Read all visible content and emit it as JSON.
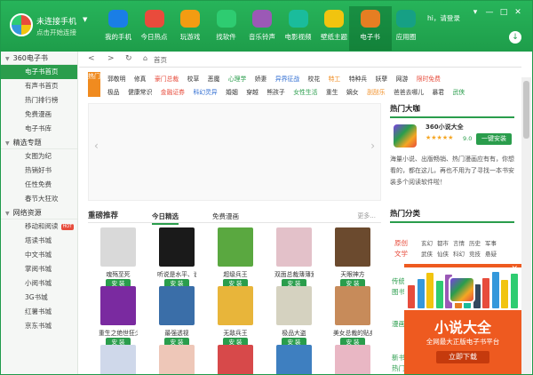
{
  "account": {
    "line1": "未连接手机",
    "line2": "点击开始连接",
    "dropdown": "▼"
  },
  "nav": [
    {
      "label": "我的手机",
      "color": "#1a7ee6"
    },
    {
      "label": "今日热点",
      "color": "#e94b3c"
    },
    {
      "label": "玩游戏",
      "color": "#f39c12"
    },
    {
      "label": "找软件",
      "color": "#2ecc71"
    },
    {
      "label": "音乐铃声",
      "color": "#9b59b6"
    },
    {
      "label": "电影视频",
      "color": "#1abc9c"
    },
    {
      "label": "壁纸主题",
      "color": "#f1c40f"
    },
    {
      "label": "电子书",
      "color": "#e67e22"
    },
    {
      "label": "应用圈",
      "color": "#16a085"
    }
  ],
  "header": {
    "hi": "hi，请登录",
    "win_buttons": [
      "▾",
      "—",
      "□",
      "✕"
    ],
    "download_icon": "↓"
  },
  "sidebar": {
    "sections": [
      {
        "title": "360电子书",
        "items": [
          {
            "label": "电子书首页",
            "active": true
          },
          {
            "label": "有声书首页"
          },
          {
            "label": "热门排行榜"
          },
          {
            "label": "免费漫画"
          },
          {
            "label": "电子书库"
          }
        ]
      },
      {
        "title": "精选专题",
        "items": [
          {
            "label": "女图为纪"
          },
          {
            "label": "热销好书"
          },
          {
            "label": "任性免费"
          },
          {
            "label": "春节大狂欢"
          }
        ]
      },
      {
        "title": "网络资源",
        "items": [
          {
            "label": "移动和阅读",
            "badge": "HOT"
          },
          {
            "label": "塔读书城"
          },
          {
            "label": "中文书城"
          },
          {
            "label": "掌阅书城"
          },
          {
            "label": "小阅书城"
          },
          {
            "label": "3G书城"
          },
          {
            "label": "红薯书城"
          },
          {
            "label": "京东书城"
          }
        ]
      }
    ]
  },
  "address": {
    "back": "<",
    "forward": ">",
    "refresh": "↻",
    "home_label": "首页"
  },
  "categories": {
    "hot_label": "热门",
    "row1": [
      {
        "t": "郭敬明"
      },
      {
        "t": "修真"
      },
      {
        "t": "豪门总裁",
        "c": "r"
      },
      {
        "t": "校草"
      },
      {
        "t": "恶魔"
      },
      {
        "t": "心理学",
        "c": "g"
      },
      {
        "t": "娇妻"
      },
      {
        "t": "异界征战",
        "c": "b"
      },
      {
        "t": "校花"
      },
      {
        "t": "特工",
        "c": "o"
      },
      {
        "t": "特种兵"
      },
      {
        "t": "妖孽"
      },
      {
        "t": "网游"
      },
      {
        "t": "限时免费",
        "c": "r"
      }
    ],
    "row2": [
      {
        "t": "极品"
      },
      {
        "t": "健康常识"
      },
      {
        "t": "金融证券",
        "c": "r"
      },
      {
        "t": "科幻灵异",
        "c": "b"
      },
      {
        "t": "婚姻"
      },
      {
        "t": "穿越"
      },
      {
        "t": "熊孩子"
      },
      {
        "t": "女性生活",
        "c": "g"
      },
      {
        "t": "重生"
      },
      {
        "t": "嫡女"
      },
      {
        "t": "刮刮乐",
        "c": "o"
      },
      {
        "t": "爸爸去哪儿"
      },
      {
        "t": "暴君"
      },
      {
        "t": "武侠",
        "c": "g"
      }
    ]
  },
  "banner": {
    "prev": "‹",
    "next": "›"
  },
  "hot_read": {
    "title": "热门大咖",
    "app_name": "360小说大全",
    "stars": "★★★★★",
    "score": "9.0",
    "install": "一键安装",
    "desc": "海量小说、出版畅销、热门漫画应有有，你想看的，都在这儿，再也不用为了寻找一本书安装多个阅读软件啦！"
  },
  "recommend": {
    "title": "重磅推荐",
    "tabs": [
      "今日精选",
      "免费漫画"
    ],
    "more": "更多...",
    "install": "安 装",
    "books": [
      {
        "title": "魂殇至死",
        "color": "#d9d9d9"
      },
      {
        "title": "听说是水平、说...",
        "color": "#1a1a1a"
      },
      {
        "title": "超级兵王",
        "color": "#5aa840"
      },
      {
        "title": "双面总裁薄薄爱",
        "color": "#e3c1c9"
      },
      {
        "title": "天眼神方",
        "color": "#6b4a2e"
      },
      {
        "title": "重生之绝世狂少",
        "color": "#7a2aa0"
      },
      {
        "title": "最强透视",
        "color": "#3a6ea8"
      },
      {
        "title": "无敌兵王",
        "color": "#e8b53a"
      },
      {
        "title": "极品大盗",
        "color": "#d5d2c0"
      },
      {
        "title": "美女总裁的贴身",
        "color": "#c78b5a"
      },
      {
        "title": "",
        "color": "#cfd8ea"
      },
      {
        "title": "",
        "color": "#eec7b8"
      },
      {
        "title": "",
        "color": "#d7494a"
      },
      {
        "title": "",
        "color": "#3e7fc0"
      },
      {
        "title": "",
        "color": "#e9b7c4"
      }
    ]
  },
  "hot_categories": {
    "title": "热门分类",
    "group": "原创文学",
    "row1": [
      "玄幻",
      "都市",
      "言情",
      "历史",
      "军事"
    ],
    "row2": [
      "武侠",
      "仙侠",
      "科幻",
      "竞技",
      "悬疑"
    ]
  },
  "side_peek": [
    "传统",
    "图书",
    "漫画",
    "新书",
    "热门"
  ],
  "ad": {
    "close": "✕",
    "title": "小说大全",
    "sub": "全网最大正版电子书平台",
    "button": "立即下载"
  }
}
